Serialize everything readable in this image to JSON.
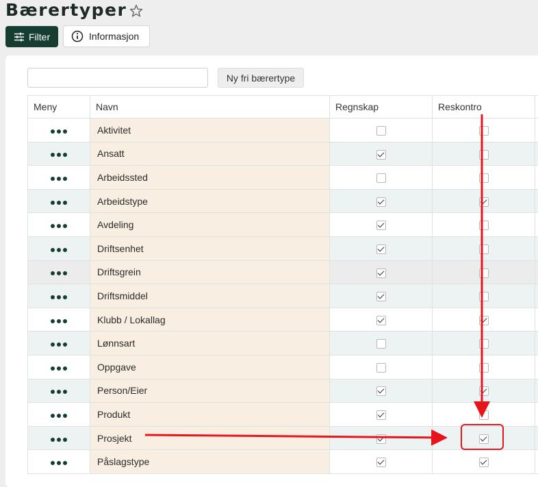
{
  "page": {
    "title": "Bærertyper"
  },
  "toolbar": {
    "filter_label": "Filter",
    "info_label": "Informasjon",
    "new_label": "Ny fri bærertype"
  },
  "search": {
    "value": "",
    "placeholder": ""
  },
  "table": {
    "columns": [
      "Meny",
      "Navn",
      "Regnskap",
      "Reskontro"
    ],
    "rows": [
      {
        "name": "Aktivitet",
        "regnskap": false,
        "reskontro": false
      },
      {
        "name": "Ansatt",
        "regnskap": true,
        "reskontro": false
      },
      {
        "name": "Arbeidssted",
        "regnskap": false,
        "reskontro": false
      },
      {
        "name": "Arbeidstype",
        "regnskap": true,
        "reskontro": true
      },
      {
        "name": "Avdeling",
        "regnskap": true,
        "reskontro": false
      },
      {
        "name": "Driftsenhet",
        "regnskap": true,
        "reskontro": false
      },
      {
        "name": "Driftsgrein",
        "regnskap": true,
        "reskontro": false
      },
      {
        "name": "Driftsmiddel",
        "regnskap": true,
        "reskontro": false
      },
      {
        "name": "Klubb / Lokallag",
        "regnskap": true,
        "reskontro": true
      },
      {
        "name": "Lønnsart",
        "regnskap": false,
        "reskontro": false
      },
      {
        "name": "Oppgave",
        "regnskap": false,
        "reskontro": false
      },
      {
        "name": "Person/Eier",
        "regnskap": true,
        "reskontro": true
      },
      {
        "name": "Produkt",
        "regnskap": true,
        "reskontro": false
      },
      {
        "name": "Prosjekt",
        "regnskap": true,
        "reskontro": true
      },
      {
        "name": "Påslagstype",
        "regnskap": true,
        "reskontro": true
      }
    ]
  },
  "colors": {
    "brand": "#163d31",
    "name_col_bg": "#f8efe2",
    "annotation": "#e8141c"
  }
}
